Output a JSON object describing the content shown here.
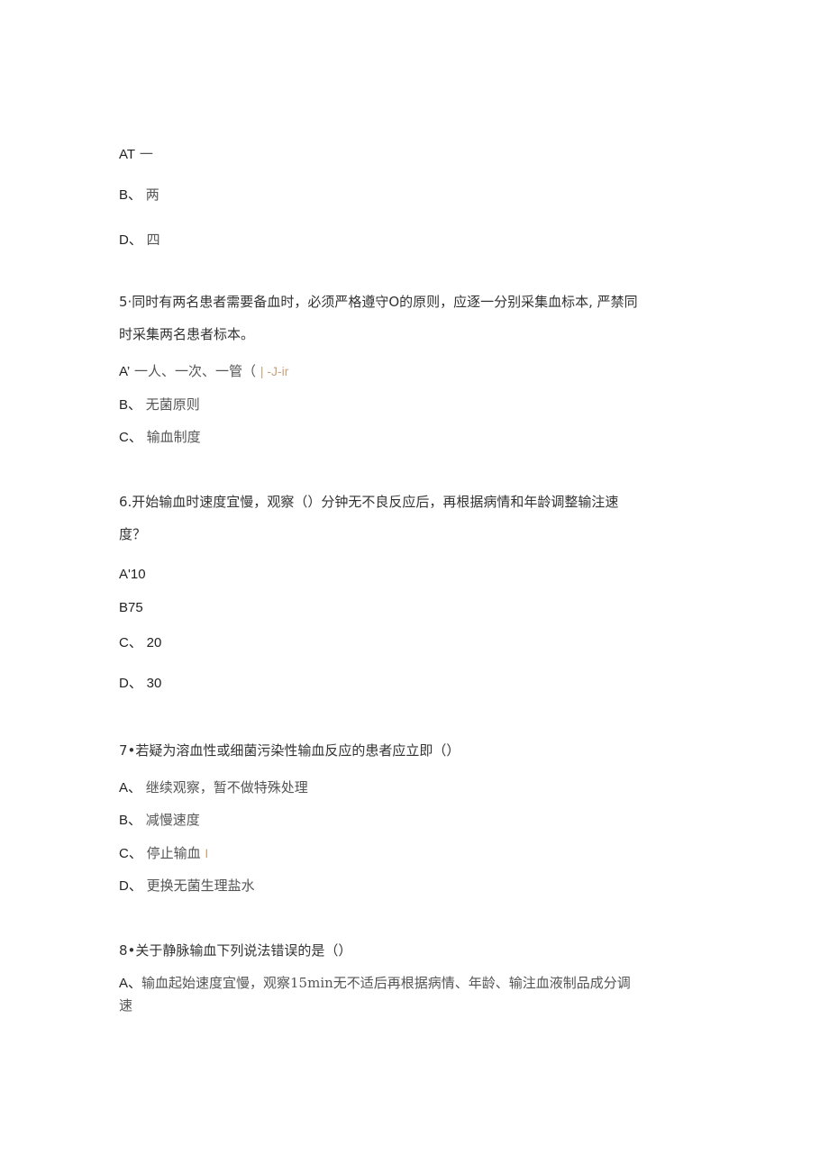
{
  "page": {
    "q4_options": [
      {
        "label": "AT",
        "text": "一"
      },
      {
        "label": "B、",
        "text": "两"
      },
      {
        "label": "D、",
        "text": "四"
      }
    ],
    "q5": {
      "stem_line1": "5·同时有两名患者需要备血时，必须严格遵守O的原则，应逐一分别采集血标本, 严禁同",
      "stem_line2": "时采集两名患者标本。",
      "options": [
        {
          "label": "A’",
          "text": "一人、一次、一管（",
          "annotation": "| -J-ir"
        },
        {
          "label": "B、",
          "text": "无菌原则"
        },
        {
          "label": "C、",
          "text": "输血制度"
        }
      ]
    },
    "q6": {
      "stem_line1": "6.开始输血时速度宜慢，观察（）分钟无不良反应后，再根据病情和年龄调整输注速",
      "stem_line2": "度？",
      "options": [
        {
          "label": "A'",
          "text": "10"
        },
        {
          "label": "B",
          "text": "75"
        },
        {
          "label": "C、",
          "text": "20"
        },
        {
          "label": "D、",
          "text": "30"
        }
      ]
    },
    "q7": {
      "stem": "7•若疑为溶血性或细菌污染性输血反应的患者应立即（）",
      "options": [
        {
          "label": "A、",
          "text": "继续观察，暂不做特殊处理"
        },
        {
          "label": "B、",
          "text": "减慢速度"
        },
        {
          "label": "C、",
          "text": "停止输血",
          "annotation": "I"
        },
        {
          "label": "D、",
          "text": "更换无菌生理盐水"
        }
      ]
    },
    "q8": {
      "stem": "8•关于静脉输血下列说法错误的是（）",
      "options": [
        {
          "label": "A、",
          "text_line1": "输血起始速度宜慢，观察15min无不适后再根据病情、年龄、输注血液制品成分调",
          "text_line2": "速"
        }
      ]
    }
  }
}
